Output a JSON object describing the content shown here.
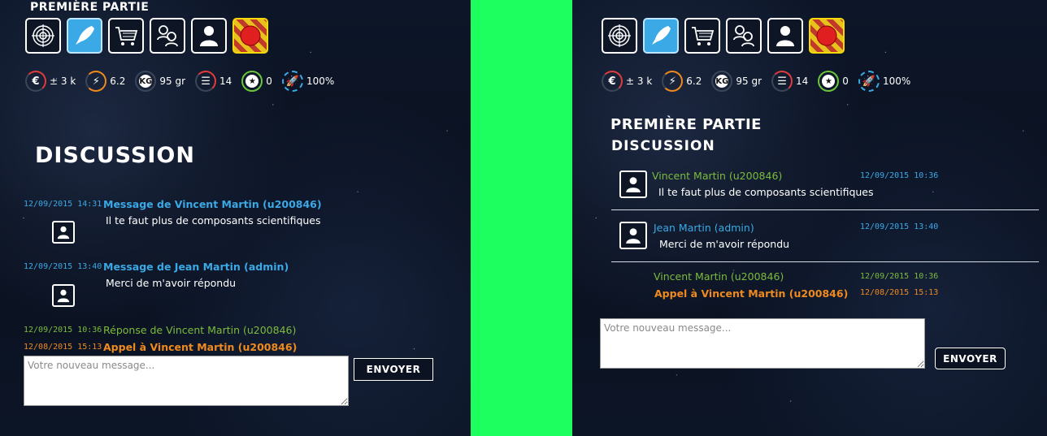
{
  "left": {
    "part_title": "PREMIÈRE PARTIE",
    "toolbar": [
      {
        "name": "target-icon",
        "active": false
      },
      {
        "name": "rocket-icon",
        "active": true
      },
      {
        "name": "cart-icon",
        "active": false
      },
      {
        "name": "astronauts-icon",
        "active": false
      },
      {
        "name": "user-icon",
        "active": false
      },
      {
        "name": "alert-icon",
        "active": false
      }
    ],
    "stats": {
      "money": "± 3 k",
      "energy": "6.2",
      "weight": "95 gr",
      "weight_badge": "KG",
      "level": "14",
      "stars": "0",
      "fuel": "100%"
    },
    "discussion_title": "DISCUSSION",
    "messages": [
      {
        "date": "12/09/2015 14:31",
        "sender": "Message de Vincent Martin (u200846)",
        "text": "Il te faut plus de composants scientifiques"
      },
      {
        "date": "12/09/2015 13:40",
        "sender": "Message de Jean Martin (admin)",
        "text": "Merci de m'avoir répondu"
      }
    ],
    "reply": {
      "date": "12/09/2015 10:36",
      "sender": "Réponse de Vincent Martin (u200846)"
    },
    "call": {
      "date": "12/08/2015 15:13",
      "sender": "Appel à Vincent Martin (u200846)"
    },
    "input_placeholder": "Votre nouveau message...",
    "send_label": "ENVOYER"
  },
  "right": {
    "part_title": "PREMIÈRE PARTIE",
    "discussion_title": "DISCUSSION",
    "stats": {
      "money": "± 3 k",
      "energy": "6.2",
      "weight": "95 gr",
      "weight_badge": "KG",
      "level": "14",
      "stars": "0",
      "fuel": "100%"
    },
    "messages": [
      {
        "date": "12/09/2015 10:36",
        "sender": "Vincent Martin (u200846)",
        "text": "Il te faut plus de composants scientifiques"
      },
      {
        "date": "12/09/2015 13:40",
        "sender": "Jean Martin (admin)",
        "text": "Merci de m'avoir répondu"
      }
    ],
    "reply": {
      "date": "12/09/2015 10:36",
      "sender": "Vincent Martin (u200846)"
    },
    "call": {
      "date": "12/08/2015 15:13",
      "sender": "Appel à Vincent Martin (u200846)"
    },
    "input_placeholder": "Votre nouveau message...",
    "send_label": "ENVOYER"
  },
  "colors": {
    "accent_blue": "#3aa9e6",
    "reply_green": "#7dbb3d",
    "call_orange": "#f08a1e",
    "divider_green": "#1dff5f"
  }
}
